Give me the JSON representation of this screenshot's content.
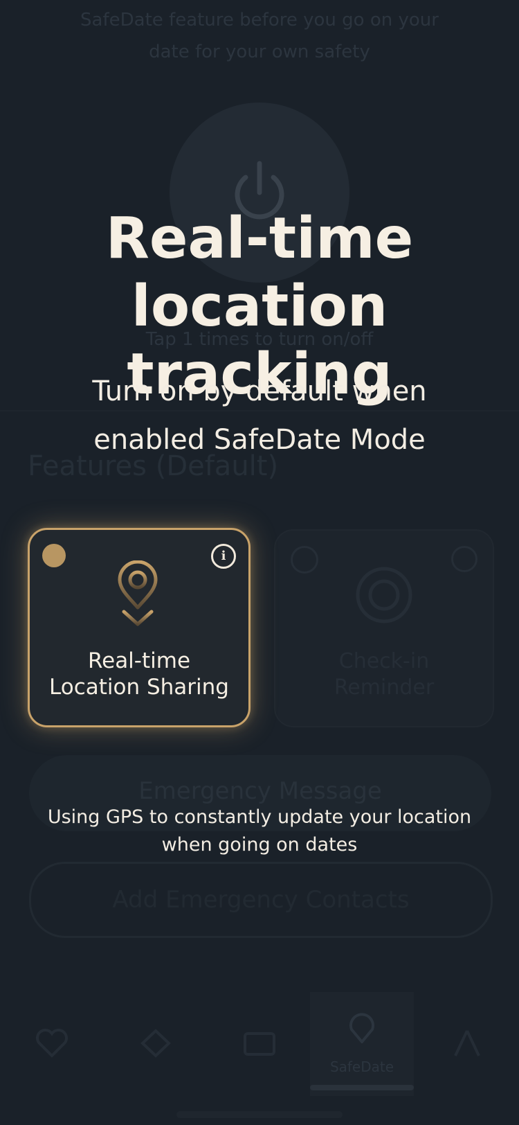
{
  "background_app": {
    "intro_line1": "SafeDate feature before you go on your",
    "intro_line2": "date for your own safety",
    "tap_hint": "Tap 1 times to turn on/off",
    "features_title": "Features (Default)",
    "card2_label_line1": "Check-in",
    "card2_label_line2": "Reminder",
    "emergency_button": "Emergency Message",
    "contacts_button": "Add Emergency Contacts",
    "tabs": [
      "",
      "",
      "",
      "SafeDate",
      ""
    ]
  },
  "overlay": {
    "headline_line1": "Real-time",
    "headline_line2": "location tracking",
    "subline_line1": "Turn on by default when",
    "subline_line2": "enabled SafeDate Mode",
    "card_label_line1": "Real-time",
    "card_label_line2": "Location Sharing",
    "info_glyph": "i",
    "caption_line1": "Using GPS to constantly update your location",
    "caption_line2": "when going on dates"
  },
  "colors": {
    "background": "#151b22",
    "accent_gold": "#c9a36a",
    "text_light": "#f6efe3",
    "card_bg": "#22282e"
  },
  "icons": [
    "power-icon",
    "location-pin-icon",
    "info-icon",
    "target-icon",
    "heart-icon",
    "diamond-icon",
    "folder-icon",
    "shield-icon",
    "profile-icon",
    "add-user-icon"
  ]
}
